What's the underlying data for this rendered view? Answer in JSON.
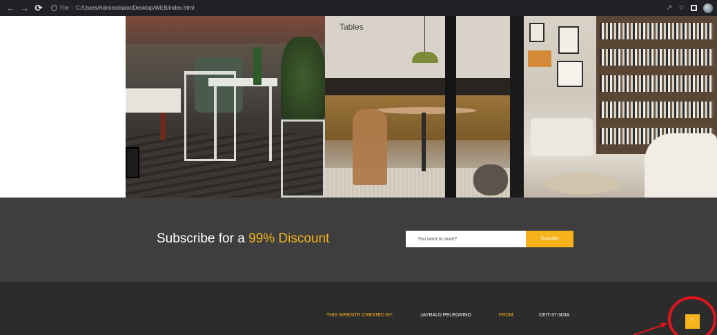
{
  "browser": {
    "url": "C:/Users/Administrator/Desktop/WEB/index.html",
    "scheme_label": "File",
    "icons": [
      "back-icon",
      "forward-icon",
      "reload-icon",
      "info-icon",
      "share-icon",
      "star-icon",
      "side-panel-icon",
      "profile-icon"
    ]
  },
  "hero": {
    "panels": [
      "outdoor-patio-photo",
      "dining-tables-photo",
      "living-room-photo"
    ],
    "tables_label": "Tables"
  },
  "subscribe": {
    "title_prefix": "Subscribe for a ",
    "title_highlight": "99% Discount",
    "input_placeholder": "You want to avail?",
    "button_label": "Subscribe"
  },
  "footer": {
    "created_by_label": "THIS WEBSITE CREATED BY:",
    "author": "JAYRALD PELEGRINO",
    "from_label": "FROM:",
    "section": "CEIT-37-303A",
    "back_to_top_glyph": "^"
  },
  "colors": {
    "accent": "#f5b21b",
    "subscribe_bg": "#3e3e3e",
    "footer_bg": "#2c2c2c",
    "annotation": "#e0141e"
  }
}
